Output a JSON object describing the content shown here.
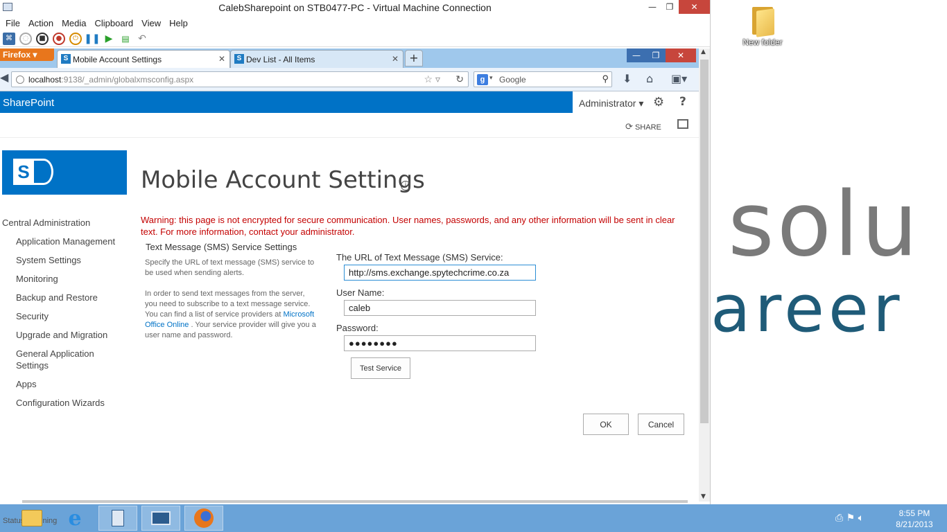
{
  "vm": {
    "title": "CalebSharepoint on STB0477-PC - Virtual Machine Connection",
    "menu": [
      "File",
      "Action",
      "Media",
      "Clipboard",
      "View",
      "Help"
    ]
  },
  "firefox": {
    "menu_button": "Firefox",
    "tabs": [
      {
        "label": "Mobile Account Settings",
        "active": true
      },
      {
        "label": "Dev List - All Items",
        "active": false
      }
    ],
    "url_host": "localhost",
    "url_rest": ":9138/_admin/globalxmsconfig.aspx",
    "search_placeholder": "Google"
  },
  "sharepoint": {
    "brand": "SharePoint",
    "user": "Administrator",
    "share_label": "SHARE",
    "page_title": "Mobile Account Settings",
    "left_nav": {
      "root": "Central Administration",
      "items": [
        "Application Management",
        "System Settings",
        "Monitoring",
        "Backup and Restore",
        "Security",
        "Upgrade and Migration",
        "General Application Settings",
        "Apps",
        "Configuration Wizards"
      ]
    },
    "warning": "Warning: this page is not encrypted for secure communication. User names, passwords, and any other information will be sent in clear text. For more information, contact your administrator.",
    "section": {
      "title": "Text Message (SMS) Service Settings",
      "desc1": "Specify the URL of text message (SMS) service to be used when sending alerts.",
      "desc2_pre": "In order to send text messages from the server, you need to subscribe to a text message service. You can find a list of service providers at",
      "desc2_link": "Microsoft Office Online",
      "desc2_post": ". Your service provider will give you a user name and password."
    },
    "form": {
      "url_label": "The URL of Text Message (SMS) Service:",
      "url_value": "http://sms.exchange.spytechcrime.co.za",
      "user_label": "User Name:",
      "user_value": "caleb",
      "password_label": "Password:",
      "password_value": "●●●●●●●●",
      "test_button": "Test Service",
      "ok_button": "OK",
      "cancel_button": "Cancel"
    }
  },
  "desktop": {
    "folder_label": "New folder",
    "wallpaper_line1": "solu",
    "wallpaper_line2": "areer"
  },
  "taskbar": {
    "status_text": "Status: Running",
    "time": "8:55 PM",
    "date": "8/21/2013"
  }
}
